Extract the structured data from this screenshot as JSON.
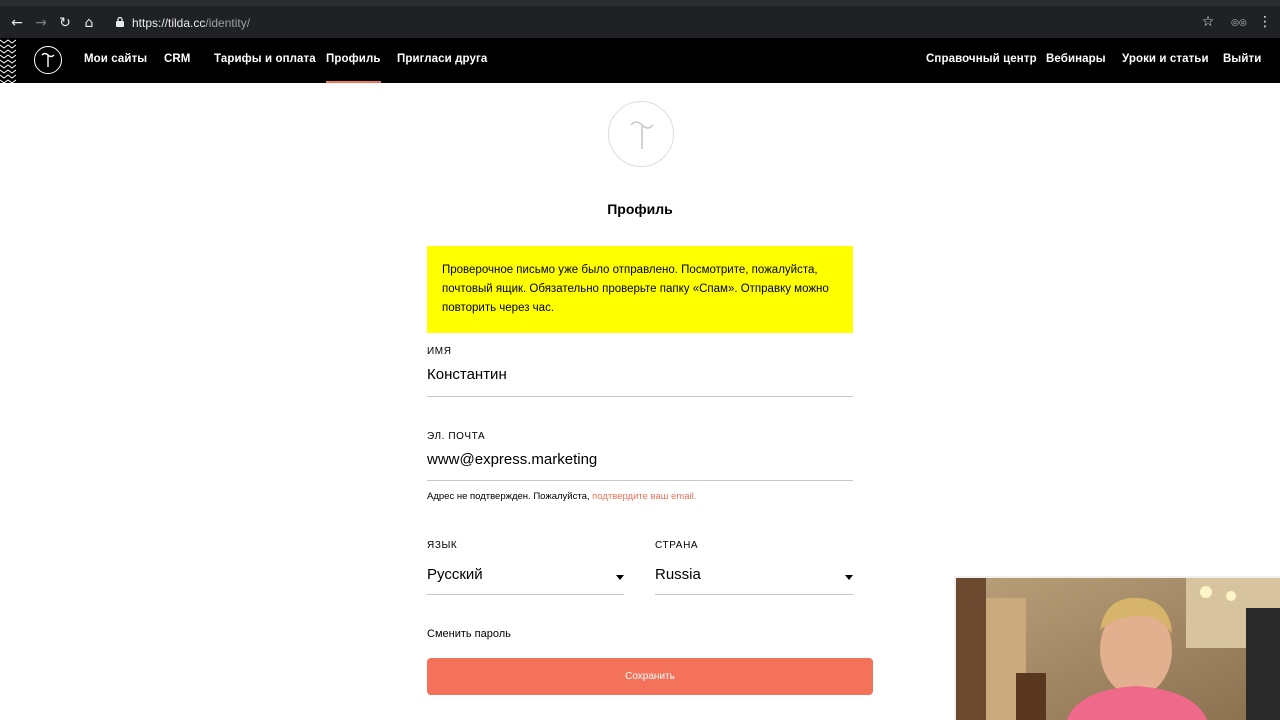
{
  "browser": {
    "url_host": "https://tilda.cc",
    "url_path": "/identity/"
  },
  "header": {
    "nav_left": [
      {
        "label": "Мои сайты"
      },
      {
        "label": "CRM"
      },
      {
        "label": "Тарифы и оплата"
      },
      {
        "label": "Профиль",
        "active": true
      },
      {
        "label": "Пригласи друга"
      }
    ],
    "nav_right": [
      {
        "label": "Справочный центр"
      },
      {
        "label": "Вебинары"
      },
      {
        "label": "Уроки и статьи"
      },
      {
        "label": "Выйти"
      }
    ]
  },
  "profile": {
    "title": "Профиль",
    "alert": "Проверочное письмо уже было отправлено. Посмотрите, пожалуйста, почтовый ящик. Обязательно проверьте папку «Спам». Отправку можно повторить через час.",
    "name_label": "имя",
    "name_value": "Константин",
    "email_label": "эл. почта",
    "email_value": "www@express.marketing",
    "email_hint": "Адрес не подтвержден. Пожалуйста, ",
    "email_hint_link": "подтвердите ваш email.",
    "language_label": "язык",
    "language_value": "Русский",
    "country_label": "страна",
    "country_value": "Russia",
    "change_password": "Сменить пароль",
    "save_button": "Сохранить"
  },
  "colors": {
    "accent": "#f4715a",
    "alert_bg": "#ffff00",
    "header_bg": "#000000"
  }
}
